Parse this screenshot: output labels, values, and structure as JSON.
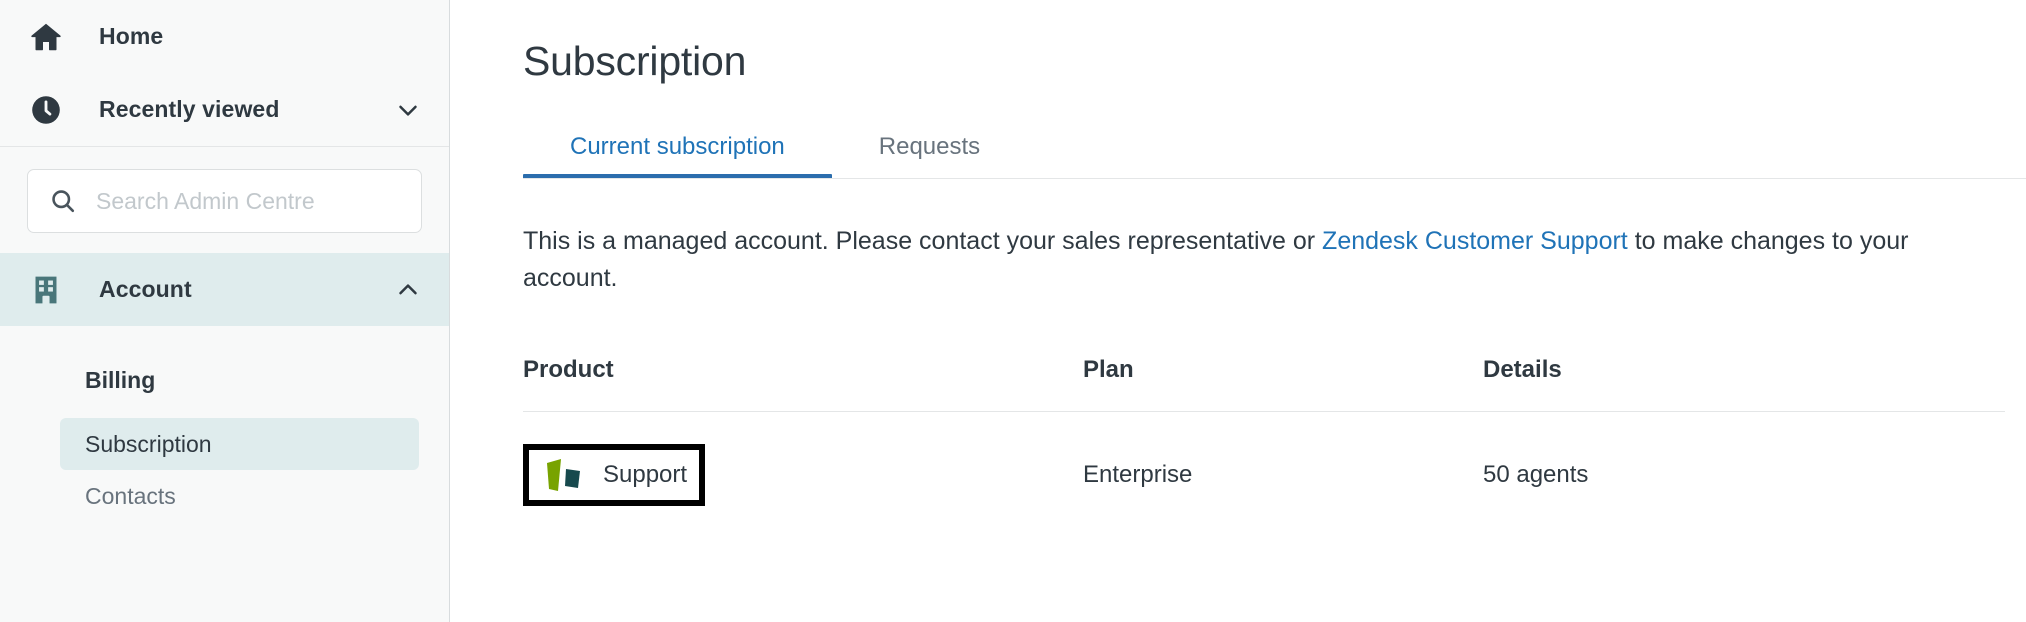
{
  "sidebar": {
    "nav": [
      {
        "label": "Home",
        "icon": "home-icon",
        "chevron": false
      },
      {
        "label": "Recently viewed",
        "icon": "clock-icon",
        "chevron": true
      }
    ],
    "search": {
      "placeholder": "Search Admin Centre",
      "value": "",
      "icon": "search-icon"
    },
    "account": {
      "label": "Account",
      "icon": "building-icon",
      "chevron": "chevron-up-icon",
      "expanded": true,
      "highlight_color": "#dfeced"
    },
    "subitems": [
      {
        "label": "Billing",
        "type": "heading",
        "selected": false
      },
      {
        "label": "Subscription",
        "type": "link",
        "selected": true
      },
      {
        "label": "Contacts",
        "type": "link",
        "selected": false
      }
    ]
  },
  "main": {
    "page_title": "Subscription",
    "tabs": [
      {
        "label": "Current subscription",
        "active": true
      },
      {
        "label": "Requests",
        "active": false
      }
    ],
    "notice": {
      "text_before": "This is a managed account. Please contact your sales representative or ",
      "link_text": "Zendesk Customer Support",
      "text_after": " to make changes to your account."
    },
    "table": {
      "headers": [
        "Product",
        "Plan",
        "Details"
      ],
      "rows": [
        {
          "product": "Support",
          "product_logo": "zendesk-support-logo",
          "product_highlighted": true,
          "plan": "Enterprise",
          "details": "50 agents"
        }
      ]
    }
  },
  "colors": {
    "accent_blue": "#1f73b7",
    "tab_underline": "#2b6dad",
    "teal_highlight": "#dfeced",
    "teal_icon": "#49767a",
    "text_primary": "#2f3941",
    "text_muted": "#68737d",
    "logo_green": "#78a300",
    "logo_dark": "#17494d"
  }
}
